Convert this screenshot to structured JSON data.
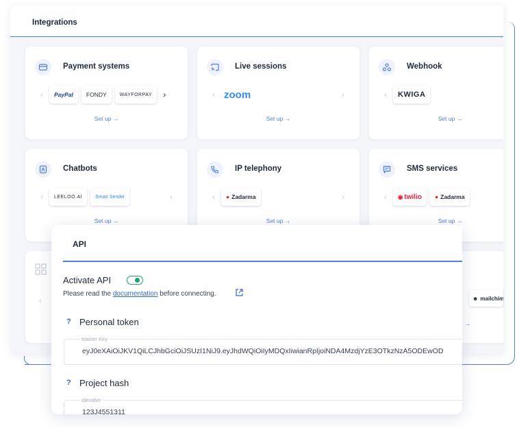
{
  "panel": {
    "title": "Integrations"
  },
  "cards": [
    {
      "title": "Payment systems",
      "icon": "credit-card-icon",
      "logos": [
        "PayPal",
        "FONDY",
        "WAYFORPAY"
      ],
      "setup": "Set up →"
    },
    {
      "title": "Live sessions",
      "icon": "cast-icon",
      "logos": [
        "zoom"
      ],
      "setup": "Set up →"
    },
    {
      "title": "Webhook",
      "icon": "webhook-icon",
      "logos": [
        "KWIGA"
      ],
      "setup": "Set up →"
    },
    {
      "title": "Chatbots",
      "icon": "bot-icon",
      "logos": [
        "LEELOO.AI",
        "Smart Sender"
      ],
      "setup": "Set up →"
    },
    {
      "title": "IP telephony",
      "icon": "phone-icon",
      "logos": [
        "Zadarma"
      ],
      "setup": "Set up →"
    },
    {
      "title": "SMS services",
      "icon": "message-icon",
      "logos": [
        "twilio",
        "Zadarma"
      ],
      "setup": "Set up →"
    }
  ],
  "hidden_row": {
    "partial_logo_a": "e",
    "partial_logo_b": "mailchim",
    "setup_arrow": "→"
  },
  "api": {
    "title": "API",
    "activate_label": "Activate API",
    "activated": true,
    "note_before": "Please read the ",
    "note_link": "documentation",
    "note_after": " before connecting.",
    "token_title": "Personal token",
    "token_label": "Master Key",
    "token_value": "eyJ0eXAiOiJKV1QiLCJhbGciOiJSUzI1NiJ9.eyJhdWQiOiIyMDQxIiwianRpIjoiNDA4MzdjYzE3OTkzNzA5ODEwOD",
    "hash_title": "Project hash",
    "hash_label": "Identifier",
    "hash_value": "123J4551311"
  },
  "colors": {
    "accent": "#4f7dde",
    "toggle_on": "#16a36e",
    "link": "#3366cc"
  }
}
